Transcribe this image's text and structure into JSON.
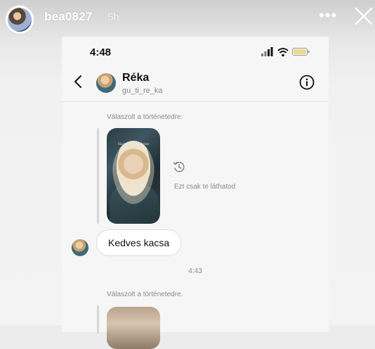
{
  "story": {
    "username": "bea0827",
    "time_ago": "5h",
    "more_icon": "more-horizontal-icon",
    "close_icon": "close-icon"
  },
  "phone": {
    "status_time": "4:48",
    "status_icons": [
      "signal-icon",
      "wifi-icon",
      "battery-icon"
    ]
  },
  "dm": {
    "header": {
      "name": "Réka",
      "handle": "gu_ti_re_ka",
      "back_icon": "chevron-left-icon",
      "info_icon": "info-icon"
    },
    "messages": [
      {
        "reply_label": "Válaszolt a történetedre.",
        "story_caption": "Vagy kedves lajos",
        "note": "Ezt csak te láthatod"
      },
      {
        "text": "Kedves kacsa"
      },
      {
        "timestamp": "4:43"
      },
      {
        "reply_label": "Válaszolt a történetedre."
      }
    ]
  }
}
